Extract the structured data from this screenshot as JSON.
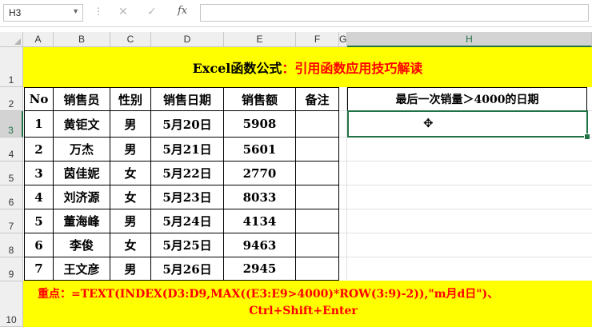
{
  "formula_bar": {
    "name_box": "H3",
    "cancel_icon": "✕",
    "enter_icon": "✓",
    "fx_label": "fx",
    "formula": ""
  },
  "columns": [
    "A",
    "B",
    "C",
    "D",
    "E",
    "F",
    "G",
    "H"
  ],
  "rows": [
    "1",
    "2",
    "3",
    "4",
    "5",
    "6",
    "7",
    "8",
    "9",
    "10"
  ],
  "selected_column": "H",
  "selected_row": "3",
  "title": {
    "black": "Excel函数公式",
    "red": "：引用函数应用技巧解读"
  },
  "table": {
    "headers": [
      "No",
      "销售员",
      "性别",
      "销售日期",
      "销售额",
      "备注"
    ],
    "rows": [
      [
        "1",
        "黄钜文",
        "男",
        "5月20日",
        "5908",
        ""
      ],
      [
        "2",
        "万杰",
        "男",
        "5月21日",
        "5601",
        ""
      ],
      [
        "3",
        "茵佳妮",
        "女",
        "5月22日",
        "2770",
        ""
      ],
      [
        "4",
        "刘济源",
        "女",
        "5月23日",
        "8033",
        ""
      ],
      [
        "5",
        "董海峰",
        "男",
        "5月24日",
        "4134",
        ""
      ],
      [
        "6",
        "李俊",
        "女",
        "5月25日",
        "9463",
        ""
      ],
      [
        "7",
        "王文彦",
        "男",
        "5月26日",
        "2945",
        ""
      ]
    ]
  },
  "result": {
    "header": "最后一次销量＞4000的日期",
    "value": ""
  },
  "note": {
    "line1": "重点：=TEXT(INDEX(D3:D9,MAX((E3:E9>4000)*ROW(3:9)-2)),\"m月d日\")、",
    "line2": "Ctrl+Shift+Enter"
  },
  "colors": {
    "yellow": "#ffff00",
    "red": "#ff0000",
    "excel_green": "#217346"
  },
  "icons": {
    "cursor": "plus-cursor-icon"
  }
}
